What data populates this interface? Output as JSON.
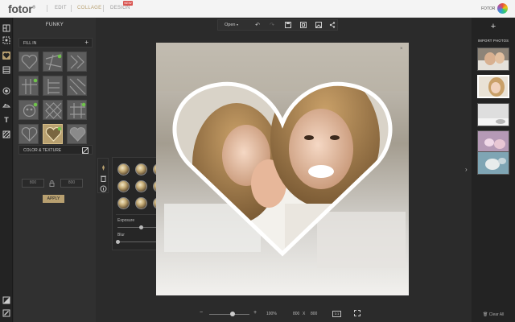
{
  "header": {
    "logo": "fotor",
    "logo_mark": "®",
    "tabs": [
      {
        "label": "EDIT",
        "active": false
      },
      {
        "label": "COLLAGE",
        "active": true
      },
      {
        "label": "DESIGN",
        "active": false
      }
    ],
    "new_badge": "NEW",
    "brand_label": "FOTOR"
  },
  "left_rail": {
    "icons": [
      "template-icon",
      "freestyle-icon",
      "shape-icon",
      "stitch-icon",
      "sticker-icon",
      "clipart-icon",
      "text-icon",
      "pattern-icon"
    ],
    "bottom_icons": [
      "background-icon",
      "edit-icon"
    ]
  },
  "panel": {
    "title": "FUNKY",
    "fill_in_label": "FILL IN",
    "fill_in_action": "+",
    "color_texture_label": "COLOR & TEXTURE",
    "width_value": "800",
    "height_value": "800",
    "apply_label": "APPLY",
    "selected_shape": "heart"
  },
  "filter_popup": {
    "exposure_label": "Exposure",
    "exposure_value": "0",
    "blur_label": "Blur",
    "blur_value": "0"
  },
  "toolbar": {
    "open_label": "Open",
    "icons": [
      "undo-icon",
      "redo-icon",
      "save-icon",
      "crop-icon",
      "image-icon",
      "share-icon"
    ]
  },
  "zoom": {
    "minus": "−",
    "plus": "+",
    "zoom_value": "100%",
    "width": "800",
    "x": "X",
    "height": "800",
    "ratio": "1:1"
  },
  "right_panel": {
    "import_label": "IMPORT PHOTOS",
    "thumbnail_count": 5,
    "clear_all": "Clear All"
  },
  "colors": {
    "accent": "#b8a070",
    "panel": "#303030",
    "background": "#2b2b2b"
  }
}
